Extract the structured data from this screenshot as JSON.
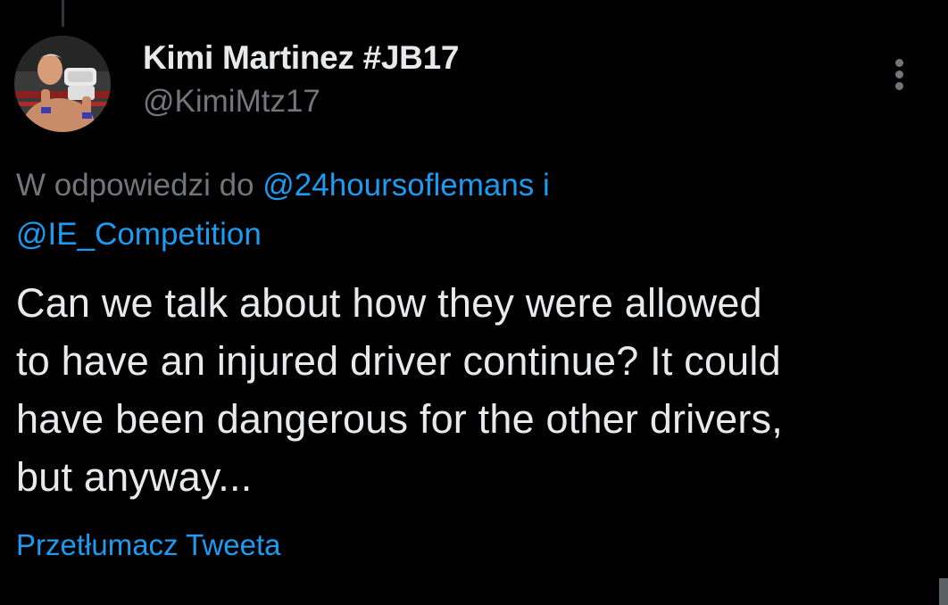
{
  "author": {
    "name": "Kimi Martinez #JB17",
    "handle": "@KimiMtz17",
    "avatar_icon": "profile-photo"
  },
  "reply_context": {
    "prefix": "W odpowiedzi do ",
    "mention_1": "@24hoursoflemans",
    "joiner": " i",
    "mention_2": "@IE_Competition"
  },
  "tweet": {
    "text_line_1": "Can we talk about how they were allowed",
    "text_line_2": "to have an injured driver continue? It could",
    "text_line_3": "have been dangerous for the other drivers,",
    "text_line_4": "but anyway..."
  },
  "actions": {
    "translate_label": "Przetłumacz Tweeta",
    "more_icon": "more-vertical-icon"
  },
  "colors": {
    "background": "#000000",
    "primary_text": "#e7e9ea",
    "secondary_text": "#71767b",
    "link": "#1d9bf0"
  }
}
